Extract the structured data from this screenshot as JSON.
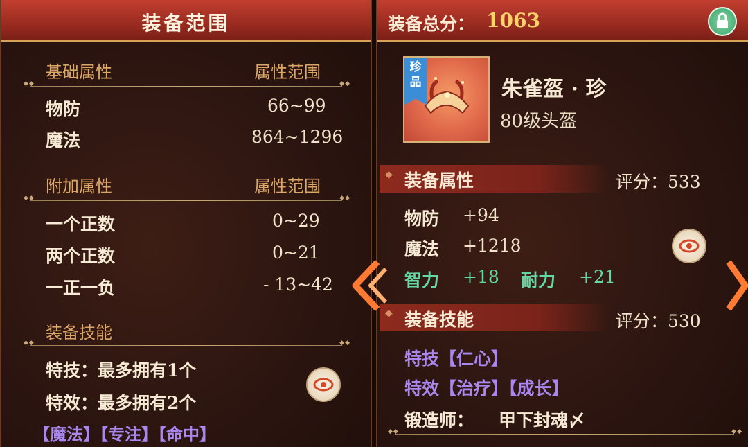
{
  "left": {
    "title": "装备范围",
    "base_header": "基础属性",
    "base_range_header": "属性范围",
    "base_stats": [
      {
        "name": "物防",
        "range": "66~99"
      },
      {
        "name": "魔法",
        "range": "864~1296"
      }
    ],
    "extra_header": "附加属性",
    "extra_range_header": "属性范围",
    "extra_stats": [
      {
        "name": "一个正数",
        "range": "0~29"
      },
      {
        "name": "两个正数",
        "range": "0~21"
      },
      {
        "name": "一正一负",
        "range": "- 13~42"
      }
    ],
    "skill_header": "装备技能",
    "skill_lines": [
      "特技：最多拥有1个",
      "特效：最多拥有2个"
    ],
    "skill_tags": "【魔法】【专注】【命中】"
  },
  "right": {
    "total_label": "装备总分：",
    "total_value": "1063",
    "rarity_tag": "珍品",
    "item_name": "朱雀盔 · 珍",
    "item_level_type": "80级头盔",
    "attr_section": "装备属性",
    "attr_score": "评分：533",
    "attrs": [
      {
        "name": "物防",
        "value": "+94"
      },
      {
        "name": "魔法",
        "value": "+1218"
      }
    ],
    "bonus": [
      {
        "name": "智力",
        "value": "+18"
      },
      {
        "name": "耐力",
        "value": "+21"
      }
    ],
    "skill_section": "装备技能",
    "skill_score": "评分：530",
    "skill_lines": [
      "特技【仁心】",
      "特效【治疗】【成长】"
    ],
    "smith_label": "锻造师：",
    "smith_name": "甲下封魂〆"
  },
  "colors": {
    "gold": "#dca766",
    "purple": "#a987ef",
    "green": "#63d8a4",
    "header_red": "#b5372a"
  },
  "icons": [
    "eye-icon",
    "lock-icon",
    "chevron-left-icon",
    "chevron-right-icon",
    "helmet-icon"
  ]
}
